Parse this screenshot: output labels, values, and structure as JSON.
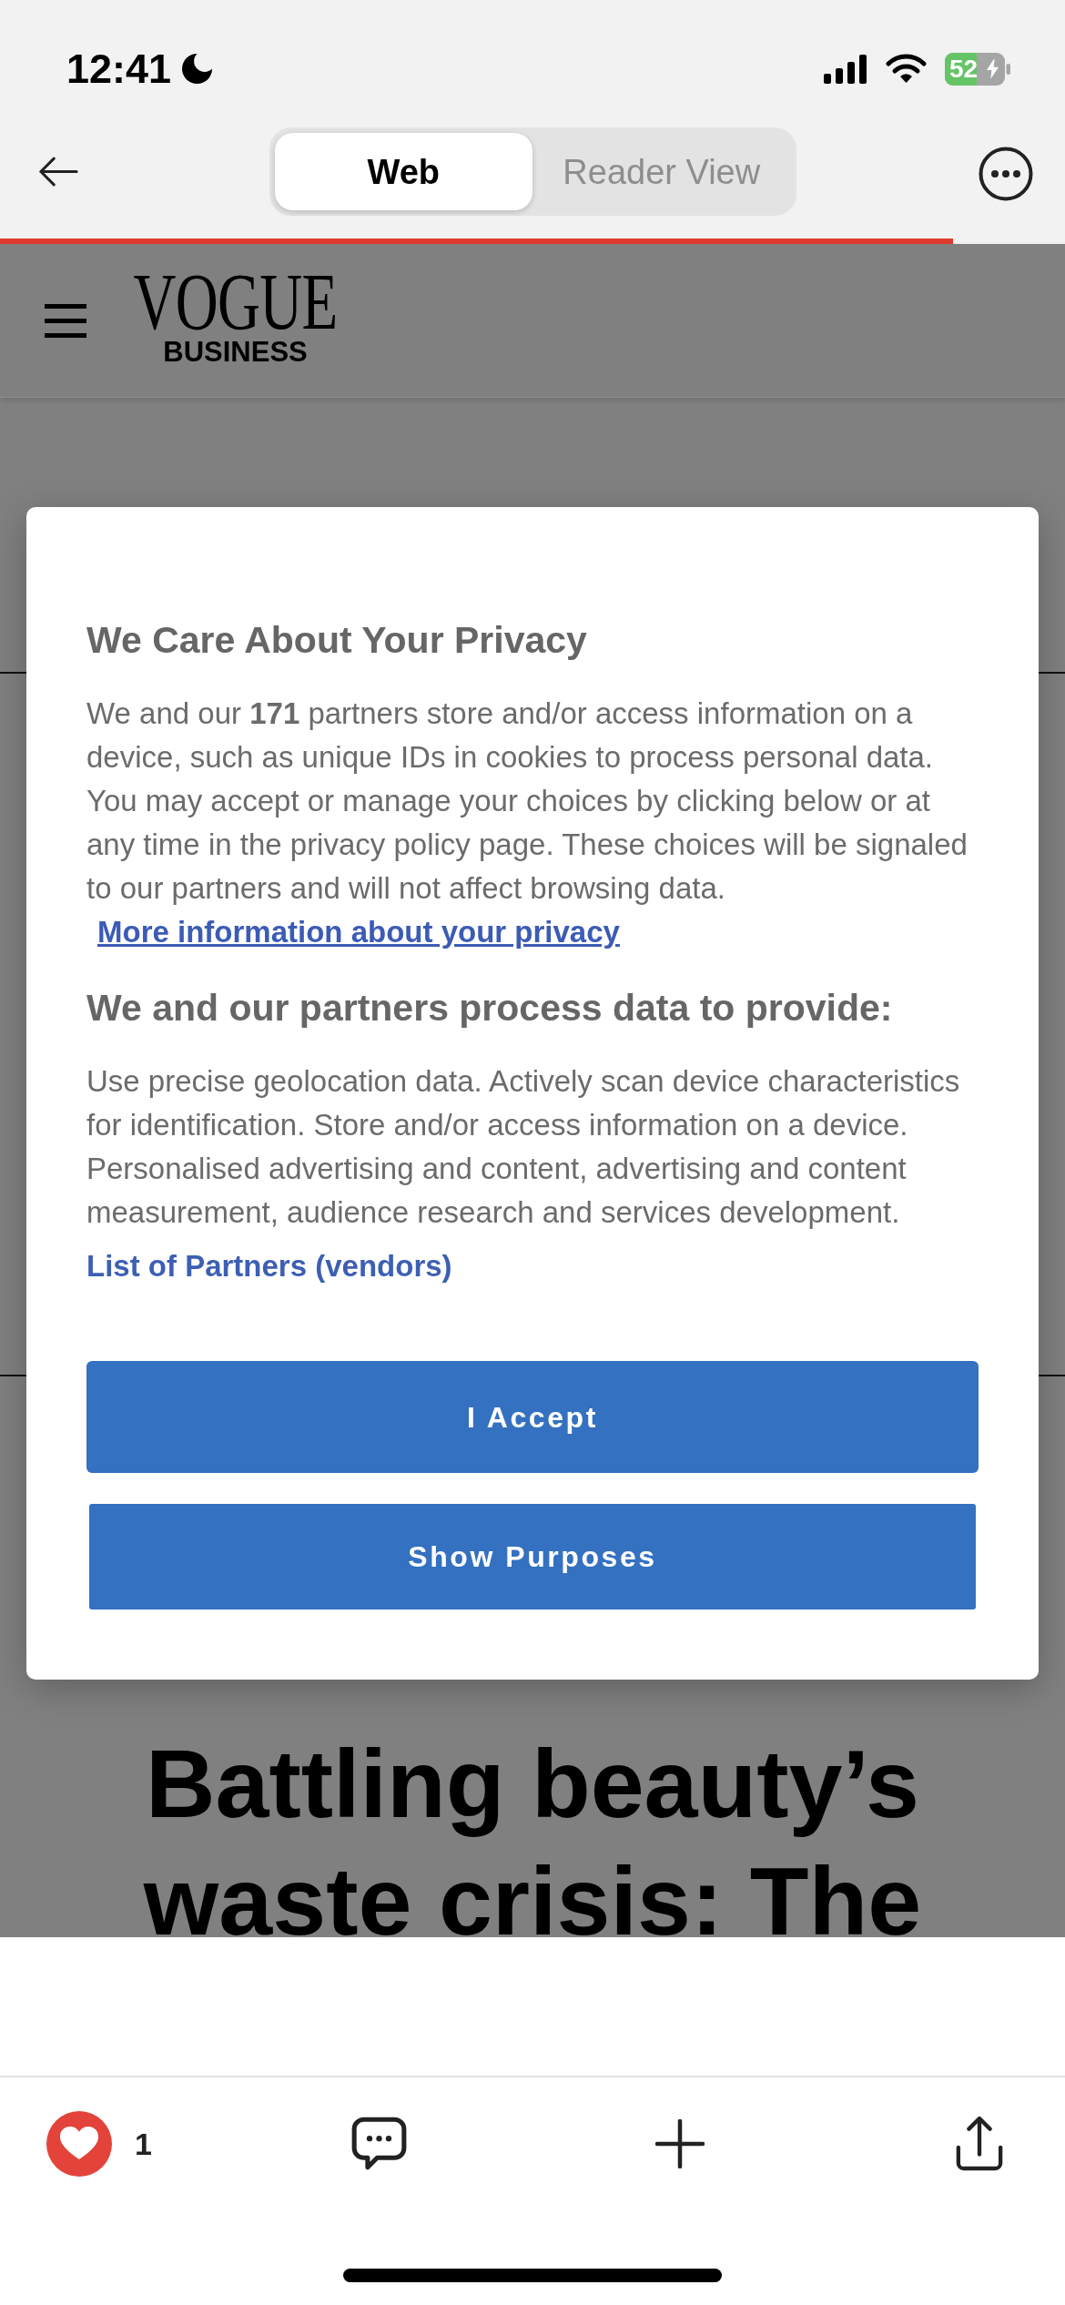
{
  "status_bar": {
    "time": "12:41",
    "battery_percent": "52"
  },
  "nav_bar": {
    "tabs": [
      {
        "label": "Web",
        "selected": true
      },
      {
        "label": "Reader View",
        "selected": false
      }
    ],
    "load_progress": {
      "level": 0.895
    }
  },
  "site_header": {
    "logo_wordmark": "VOGUE",
    "logo_subtitle": "BUSINESS"
  },
  "consent_dialog": {
    "title": "We Care About Your Privacy",
    "notice": "We and our **171** partners store and/or access information on a device, such as unique IDs in cookies to process personal data. You may accept or manage your choices by clicking below or at any time in the privacy policy page. These choices will be signaled to our partners and will not affect browsing data.",
    "notice_link": "More information about your privacy",
    "purposes_heading": "We and our partners process data to provide:",
    "purposes_text": "Use precise geolocation data. Actively scan device characteristics for identification. Store and/or access information on a device. Personalised advertising and content, advertising and content measurement, audience research and services development.",
    "partners_link": "List of Partners (vendors)",
    "buttons": [
      "I Accept",
      "Show Purposes"
    ]
  },
  "article": {
    "headline": "Battling beauty’s waste crisis: The"
  },
  "toolbar": {
    "liked": true,
    "like_count": "1"
  }
}
